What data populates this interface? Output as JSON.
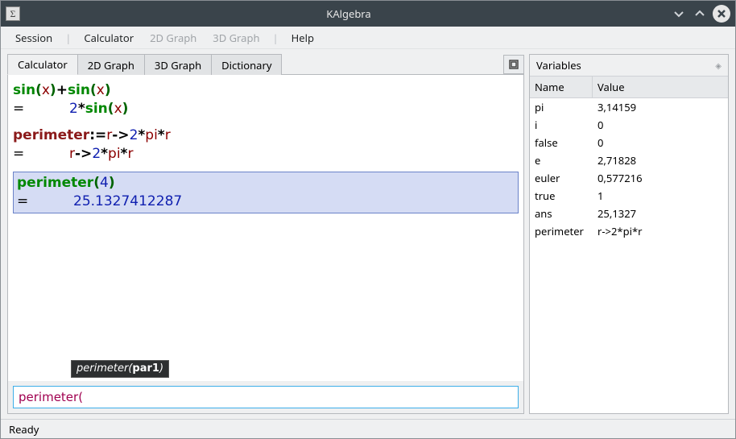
{
  "window": {
    "title": "KAlgebra"
  },
  "menu": {
    "session": "Session",
    "calculator": "Calculator",
    "graph2d": "2D Graph",
    "graph3d": "3D Graph",
    "help": "Help"
  },
  "tabs": {
    "calculator": "Calculator",
    "graph2d": "2D Graph",
    "graph3d": "3D Graph",
    "dictionary": "Dictionary"
  },
  "output": {
    "e1": {
      "expr_parts": [
        "sin",
        "(",
        "x",
        ")",
        "+",
        "sin",
        "(",
        "x",
        ")"
      ],
      "res_parts": [
        "2",
        "*",
        "sin",
        "(",
        "x",
        ")"
      ]
    },
    "e2": {
      "expr_parts": [
        "perimeter",
        ":=",
        "r",
        "->",
        "2",
        "*",
        "pi",
        "*",
        "r"
      ],
      "res_parts": [
        "r",
        "->",
        "2",
        "*",
        "pi",
        "*",
        "r"
      ]
    },
    "e3": {
      "expr_parts": [
        "perimeter",
        "(",
        "4",
        ")"
      ],
      "res": "25.1327412287"
    }
  },
  "tooltip": {
    "fn": "perimeter",
    "arg": "par1"
  },
  "input": {
    "value": "perimeter("
  },
  "vars": {
    "title": "Variables",
    "col_name": "Name",
    "col_value": "Value",
    "rows": [
      {
        "n": "pi",
        "v": "3,14159"
      },
      {
        "n": "i",
        "v": "0"
      },
      {
        "n": "false",
        "v": "0"
      },
      {
        "n": "e",
        "v": "2,71828"
      },
      {
        "n": "euler",
        "v": "0,577216"
      },
      {
        "n": "true",
        "v": "1"
      },
      {
        "n": "ans",
        "v": "25,1327"
      },
      {
        "n": "perimeter",
        "v": "r->2*pi*r"
      }
    ]
  },
  "equals": "=",
  "status": "Ready"
}
